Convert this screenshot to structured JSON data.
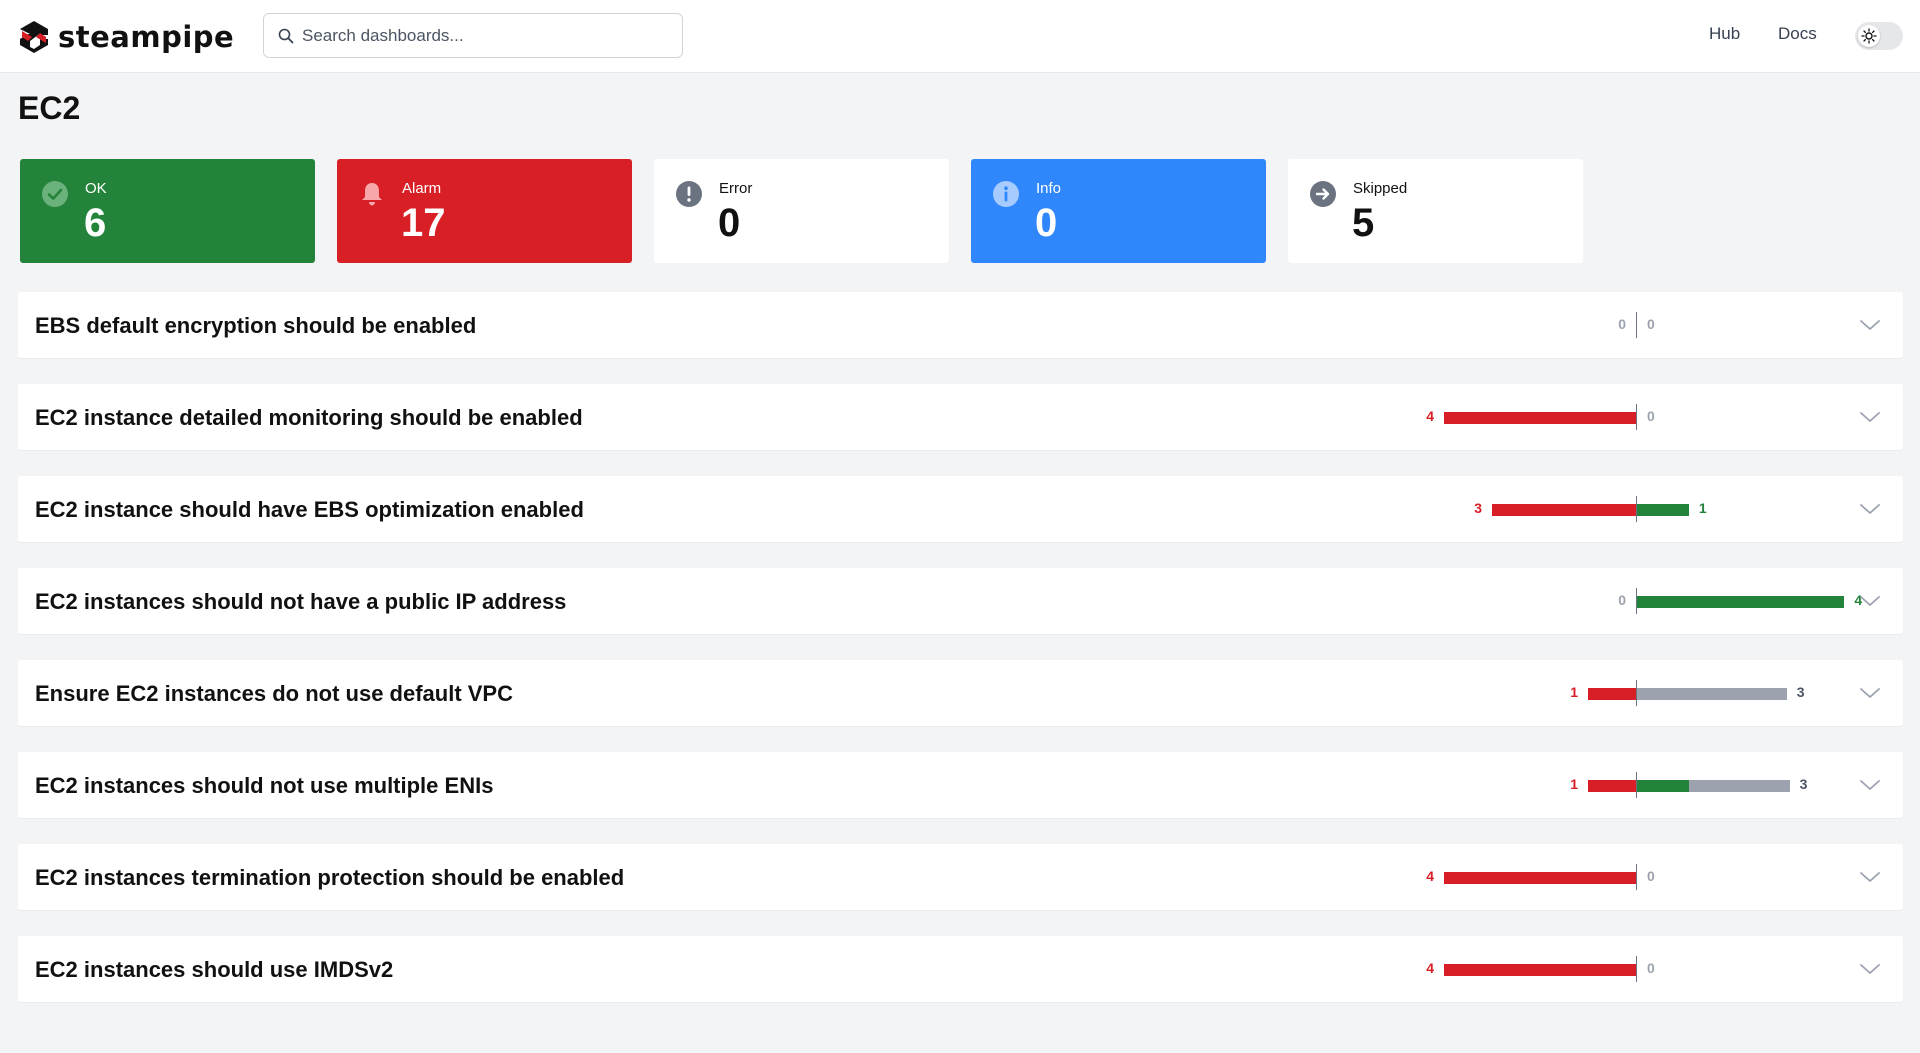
{
  "app": {
    "logo_text": "steampipe",
    "search_placeholder": "Search dashboards...",
    "nav": {
      "hub": "Hub",
      "docs": "Docs"
    },
    "theme_toggle_icon": "sun-icon"
  },
  "page": {
    "title": "EC2"
  },
  "summary": [
    {
      "label": "OK",
      "value": "6",
      "icon": "check-circle-icon",
      "color": "#23833a"
    },
    {
      "label": "Alarm",
      "value": "17",
      "icon": "bell-icon",
      "color": "#d91f26"
    },
    {
      "label": "Error",
      "value": "0",
      "icon": "exclamation-circle-icon",
      "color": "#ffffff"
    },
    {
      "label": "Info",
      "value": "0",
      "icon": "info-circle-icon",
      "color": "#2f87fb"
    },
    {
      "label": "Skipped",
      "value": "5",
      "icon": "arrow-right-circle-icon",
      "color": "#ffffff"
    }
  ],
  "controls": [
    {
      "title": "EBS default encryption should be enabled",
      "alarm": 0,
      "ok": 0,
      "skip": 0,
      "left_label": "0",
      "right_label": "0"
    },
    {
      "title": "EC2 instance detailed monitoring should be enabled",
      "alarm": 4,
      "ok": 0,
      "skip": 0,
      "left_label": "4",
      "right_label": "0"
    },
    {
      "title": "EC2 instance should have EBS optimization enabled",
      "alarm": 3,
      "ok": 1,
      "skip": 0,
      "left_label": "3",
      "right_label": "1"
    },
    {
      "title": "EC2 instances should not have a public IP address",
      "alarm": 0,
      "ok": 4,
      "skip": 0,
      "left_label": "0",
      "right_label": "4"
    },
    {
      "title": "Ensure EC2 instances do not use default VPC",
      "alarm": 1,
      "ok": 0,
      "skip": 3,
      "left_label": "1",
      "right_label": "3"
    },
    {
      "title": "EC2 instances should not use multiple ENIs",
      "alarm": 1,
      "ok": 1,
      "skip": 2,
      "left_label": "1",
      "right_label": "3"
    },
    {
      "title": "EC2 instances termination protection should be enabled",
      "alarm": 4,
      "ok": 0,
      "skip": 0,
      "left_label": "4",
      "right_label": "0"
    },
    {
      "title": "EC2 instances should use IMDSv2",
      "alarm": 4,
      "ok": 0,
      "skip": 0,
      "left_label": "4",
      "right_label": "0"
    }
  ],
  "colors": {
    "alarm": "#d91f26",
    "ok": "#23833a",
    "skip": "#9ca3af"
  }
}
